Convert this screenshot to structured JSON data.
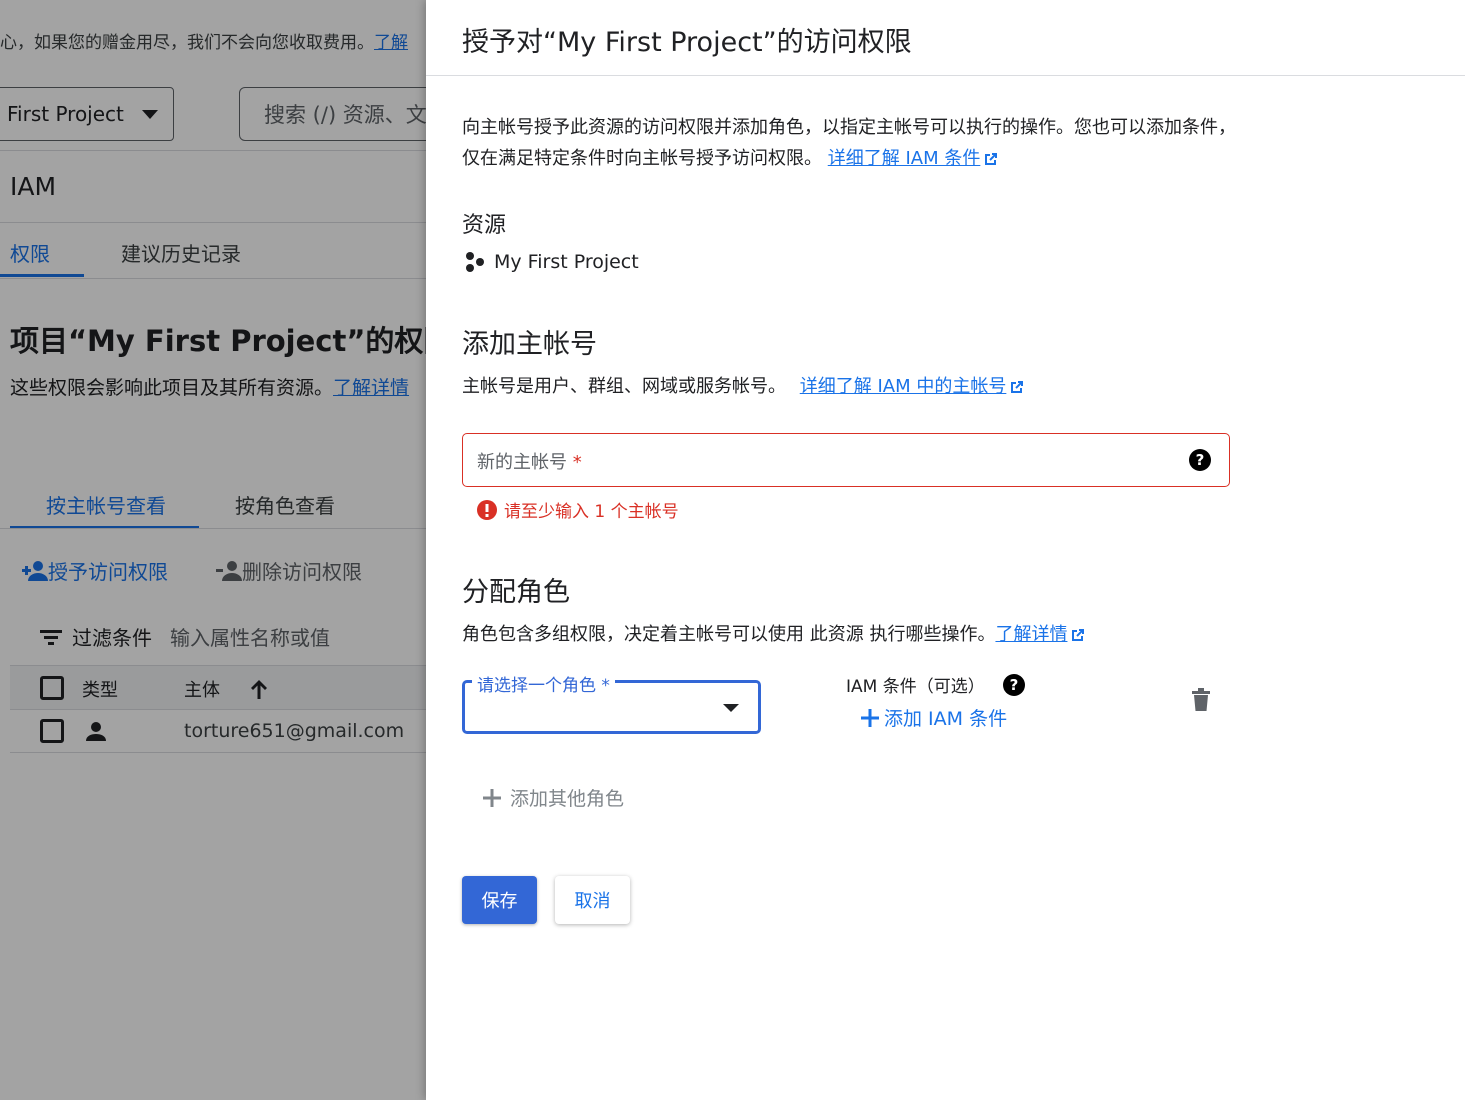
{
  "background": {
    "promo_text": "心，如果您的赠金用尽，我们不会向您收取费用。",
    "promo_link": "了解",
    "project_selector": "First Project",
    "search_placeholder": "搜索 (/) 资源、文",
    "page_title": "IAM",
    "tabs": [
      {
        "label": "权限"
      },
      {
        "label": "建议历史记录"
      }
    ],
    "permissions_heading": "项目“My First Project”的权限",
    "permissions_desc": "这些权限会影响此项目及其所有资源。",
    "permissions_link": "了解详情",
    "view_tabs": [
      {
        "label": "按主帐号查看"
      },
      {
        "label": "按角色查看"
      }
    ],
    "actions": {
      "grant": "授予访问权限",
      "remove": "删除访问权限"
    },
    "filter": {
      "label": "过滤条件",
      "placeholder": "输入属性名称或值"
    },
    "table": {
      "columns": [
        "类型",
        "主体"
      ],
      "rows": [
        {
          "principal": "torture651@gmail.com"
        }
      ]
    }
  },
  "panel": {
    "title": "授予对“My First Project”的访问权限",
    "intro_text": "向主帐号授予此资源的访问权限并添加角色，以指定主帐号可以执行的操作。您也可以添加条件，仅在满足特定条件时向主帐号授予访问权限。",
    "intro_link": "详细了解 IAM 条件",
    "resource_heading": "资源",
    "resource_name": "My First Project",
    "add_principals_heading": "添加主帐号",
    "add_principals_desc": "主帐号是用户、群组、网域或服务帐号。",
    "add_principals_link": "详细了解 IAM 中的主帐号",
    "principal_placeholder": "新的主帐号",
    "required_mark": "*",
    "principal_error": "请至少输入 1 个主帐号",
    "assign_roles_heading": "分配角色",
    "assign_roles_desc": "角色包含多组权限，决定着主帐号可以使用 此资源 执行哪些操作。",
    "assign_roles_link": "了解详情",
    "role_select_label": "请选择一个角色",
    "condition_label": "IAM 条件（可选）",
    "add_condition": "添加 IAM 条件",
    "add_another_role": "添加其他角色",
    "save_button": "保存",
    "cancel_button": "取消"
  },
  "colors": {
    "accent": "#1a73e8",
    "primary_button": "#3367d6",
    "error": "#d93025"
  }
}
